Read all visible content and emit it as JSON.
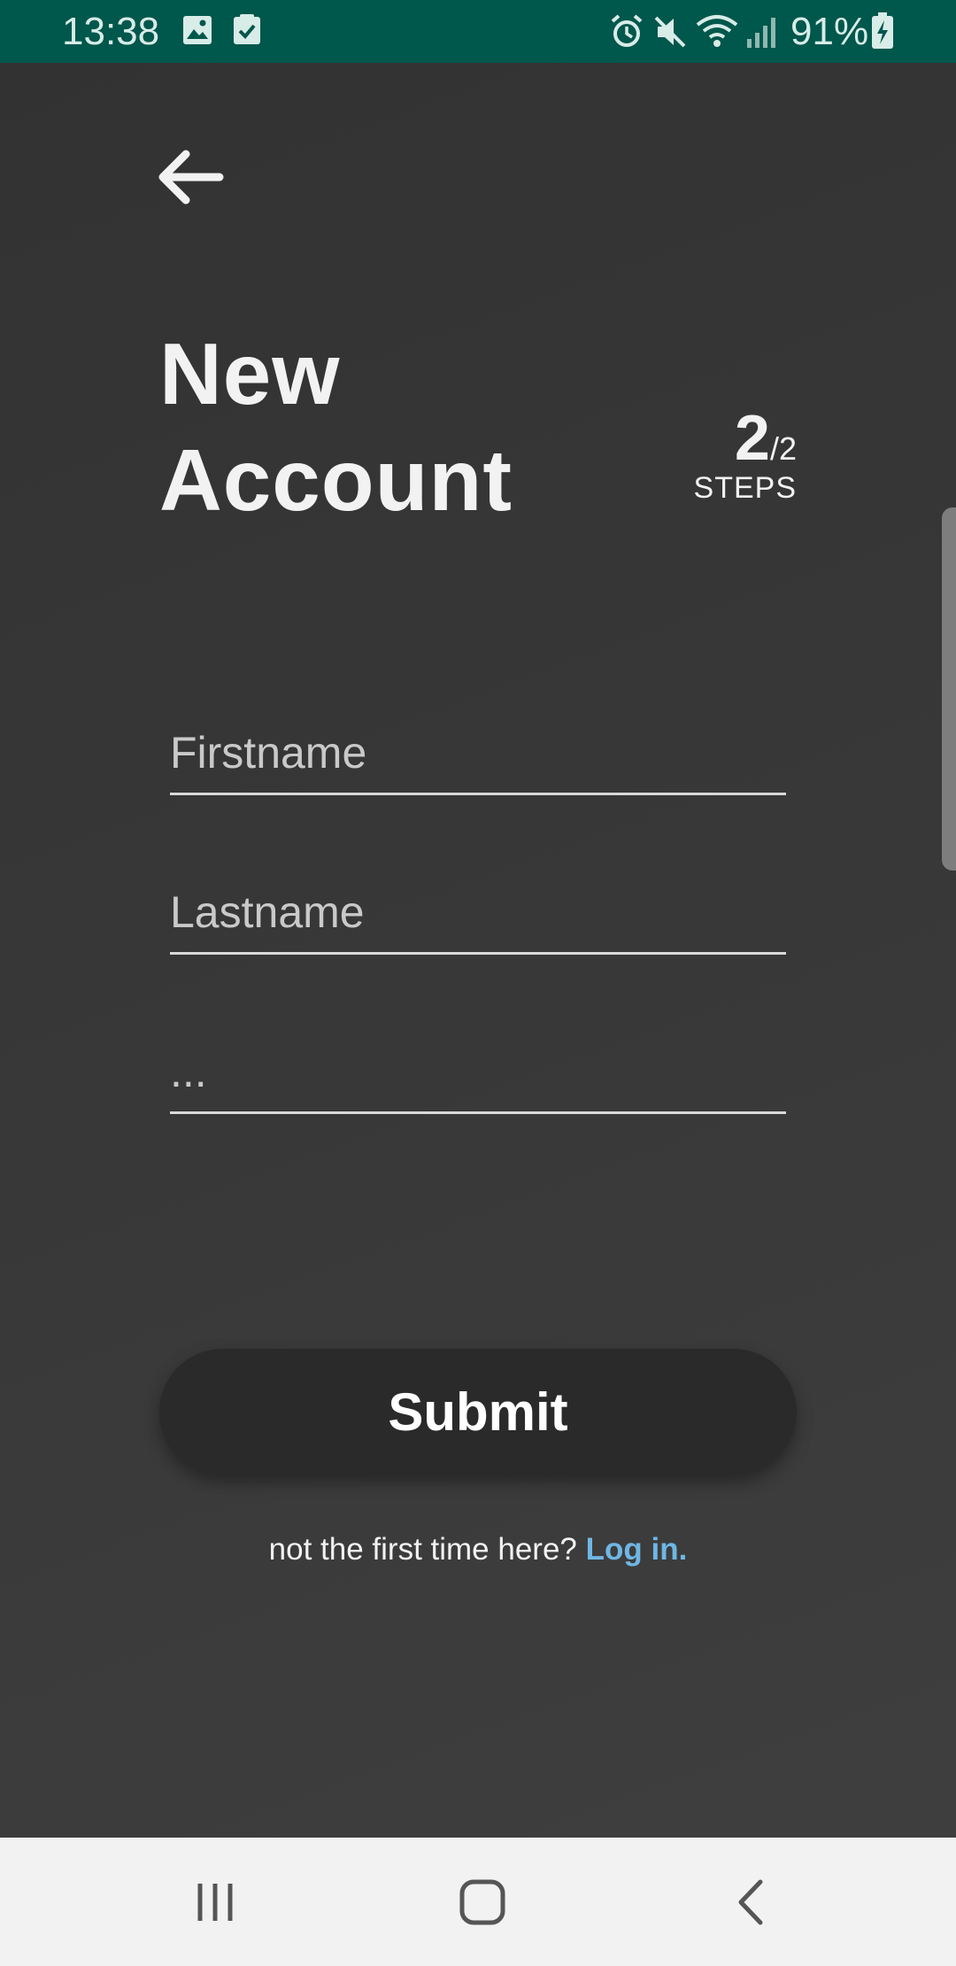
{
  "status_bar": {
    "time": "13:38",
    "battery": "91%",
    "icons": [
      "image-icon",
      "check-square-icon",
      "alarm-icon",
      "mute-icon",
      "wifi-icon",
      "signal-icon",
      "battery-charging-icon"
    ],
    "background_color": "#00574b"
  },
  "header": {
    "back_icon": "arrow-left-icon",
    "title_line1": "New",
    "title_line2": "Account"
  },
  "steps": {
    "current": "2",
    "total": "/2",
    "label": "STEPS"
  },
  "form": {
    "firstname_placeholder": "Firstname",
    "lastname_placeholder": "Lastname",
    "third_placeholder": "...",
    "submit_label": "Submit"
  },
  "footer": {
    "prompt": "not the first time here?",
    "login_link": "Log in.",
    "link_color": "#6fb6e4"
  },
  "nav_bar": {
    "icons": [
      "recent-apps-icon",
      "home-icon",
      "back-icon"
    ]
  }
}
